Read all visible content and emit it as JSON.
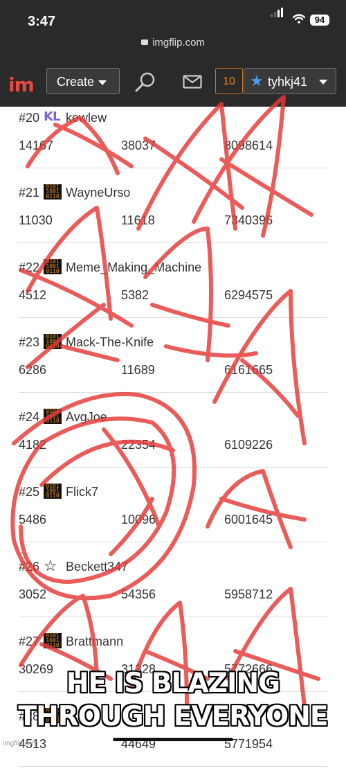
{
  "status_bar": {
    "time": "3:47",
    "url": "imgflip.com",
    "battery": "94"
  },
  "navbar": {
    "logo": "im",
    "create_label": "Create",
    "notification_count": "10",
    "username": "tyhkj41"
  },
  "leaderboard": [
    {
      "rank": "#20",
      "icon": "kl-icon",
      "icon_text": "KL",
      "username": "kewlew",
      "v1": "14167",
      "v2": "38037",
      "v3": "8098614"
    },
    {
      "rank": "#21",
      "icon": "binary-icon",
      "username": "WayneUrso",
      "v1": "11030",
      "v2": "11618",
      "v3": "7340396"
    },
    {
      "rank": "#22",
      "icon": "binary-icon",
      "username": "Meme_Making_Machine",
      "v1": "4512",
      "v2": "5382",
      "v3": "6294575"
    },
    {
      "rank": "#23",
      "icon": "binary-icon",
      "username": "Mack-The-Knife",
      "v1": "6286",
      "v2": "11689",
      "v3": "6161665"
    },
    {
      "rank": "#24",
      "icon": "binary-icon",
      "username": "AvgJoe",
      "v1": "4182",
      "v2": "22354",
      "v3": "6109226"
    },
    {
      "rank": "#25",
      "icon": "binary-icon",
      "username": "Flick7",
      "v1": "5486",
      "v2": "10096",
      "v3": "6001645"
    },
    {
      "rank": "#26",
      "icon": "star-icon",
      "icon_text": "☆",
      "username": "Beckett347",
      "v1": "3052",
      "v2": "54356",
      "v3": "5958712"
    },
    {
      "rank": "#27",
      "icon": "binary-icon",
      "username": "Brattmann",
      "v1": "30269",
      "v2": "31328",
      "v3": "5772666"
    },
    {
      "rank": "#28",
      "icon": "binary-icon",
      "username": "",
      "v1": "4513",
      "v2": "44649",
      "v3": "5771954"
    }
  ],
  "caption": {
    "line1": "HE IS BLAZING",
    "line2": "THROUGH EVERYONE"
  },
  "watermark": "imgflip.com",
  "colors": {
    "accent": "#e9493f",
    "notification": "#e08a2e",
    "scribble": "#e53935"
  }
}
